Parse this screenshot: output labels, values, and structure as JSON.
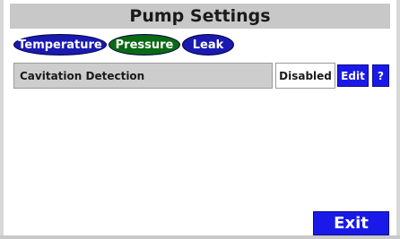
{
  "header": {
    "title": "Pump Settings"
  },
  "tabs": [
    {
      "label": "Temperature",
      "active": false
    },
    {
      "label": "Pressure",
      "active": true
    },
    {
      "label": "Leak",
      "active": false
    }
  ],
  "settings": [
    {
      "label": "Cavitation Detection",
      "value": "Disabled",
      "edit_label": "Edit",
      "help_label": "?"
    }
  ],
  "footer": {
    "exit_label": "Exit"
  },
  "colors": {
    "title_bar": "#c8c8c8",
    "tab_inactive": "#1a1ab0",
    "tab_active": "#0a6a14",
    "button": "#1a1ae8",
    "label_cell": "#cdcdcd"
  }
}
